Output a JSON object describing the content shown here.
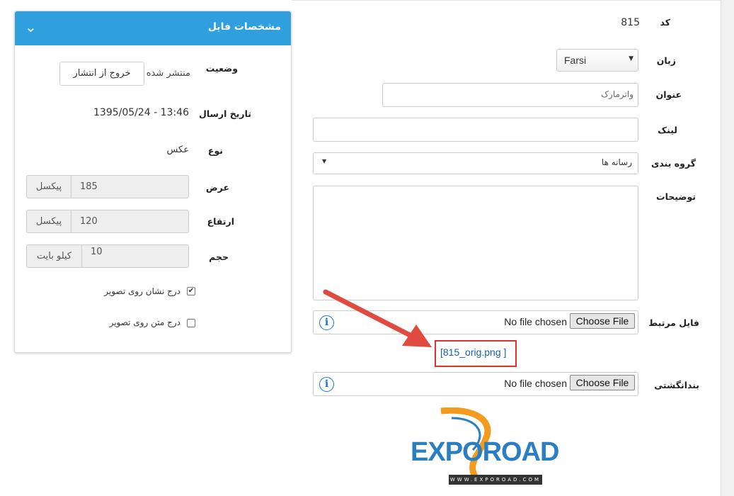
{
  "form": {
    "code_label": "کد",
    "code_value": "815",
    "language_label": "زبان",
    "language_value": "Farsi",
    "title_label": "عنوان",
    "title_value": "واترمارک",
    "link_label": "لینک",
    "link_value": "",
    "category_label": "گروه بندی",
    "category_value": "رسانه ها",
    "description_label": "توضیحات",
    "description_value": "",
    "related_file_label": "فایل مرتبط",
    "no_file_text": "No file chosen",
    "choose_file_label": "Choose File",
    "related_file_link": "[815_orig.png ]",
    "thumbnail_label": "بندانگشتی",
    "thumb_no_file_text": "No file chosen",
    "thumb_choose_file_label": "Choose File"
  },
  "card": {
    "title": "مشخصات فایل",
    "status_label": "وضعیت",
    "status_value": "منتشر شده",
    "unpublish_button": "خروج از انتشار",
    "date_label": "تاریخ ارسال",
    "date_value": "1395/05/24 - 13:46",
    "type_label": "نوع",
    "type_value": "عکس",
    "width_label": "عرض",
    "width_value": "185",
    "width_unit": "پیکسل",
    "height_label": "ارتفاع",
    "height_value": "120",
    "height_unit": "پیکسل",
    "size_label": "حجم",
    "size_value": "10",
    "size_unit": "کیلو بایت",
    "watermark_checkbox_label": "درج نشان روی تصویر",
    "watermark_checked": true,
    "text_checkbox_label": "درج متن روی تصویر",
    "text_checked": false
  },
  "logo": {
    "text": "EXPOROAD",
    "url_text": "WWW.EXPOROAD.COM"
  },
  "colors": {
    "accent": "#2f9fdd",
    "arrow": "#e04a3f",
    "link": "#1a5fb4"
  }
}
